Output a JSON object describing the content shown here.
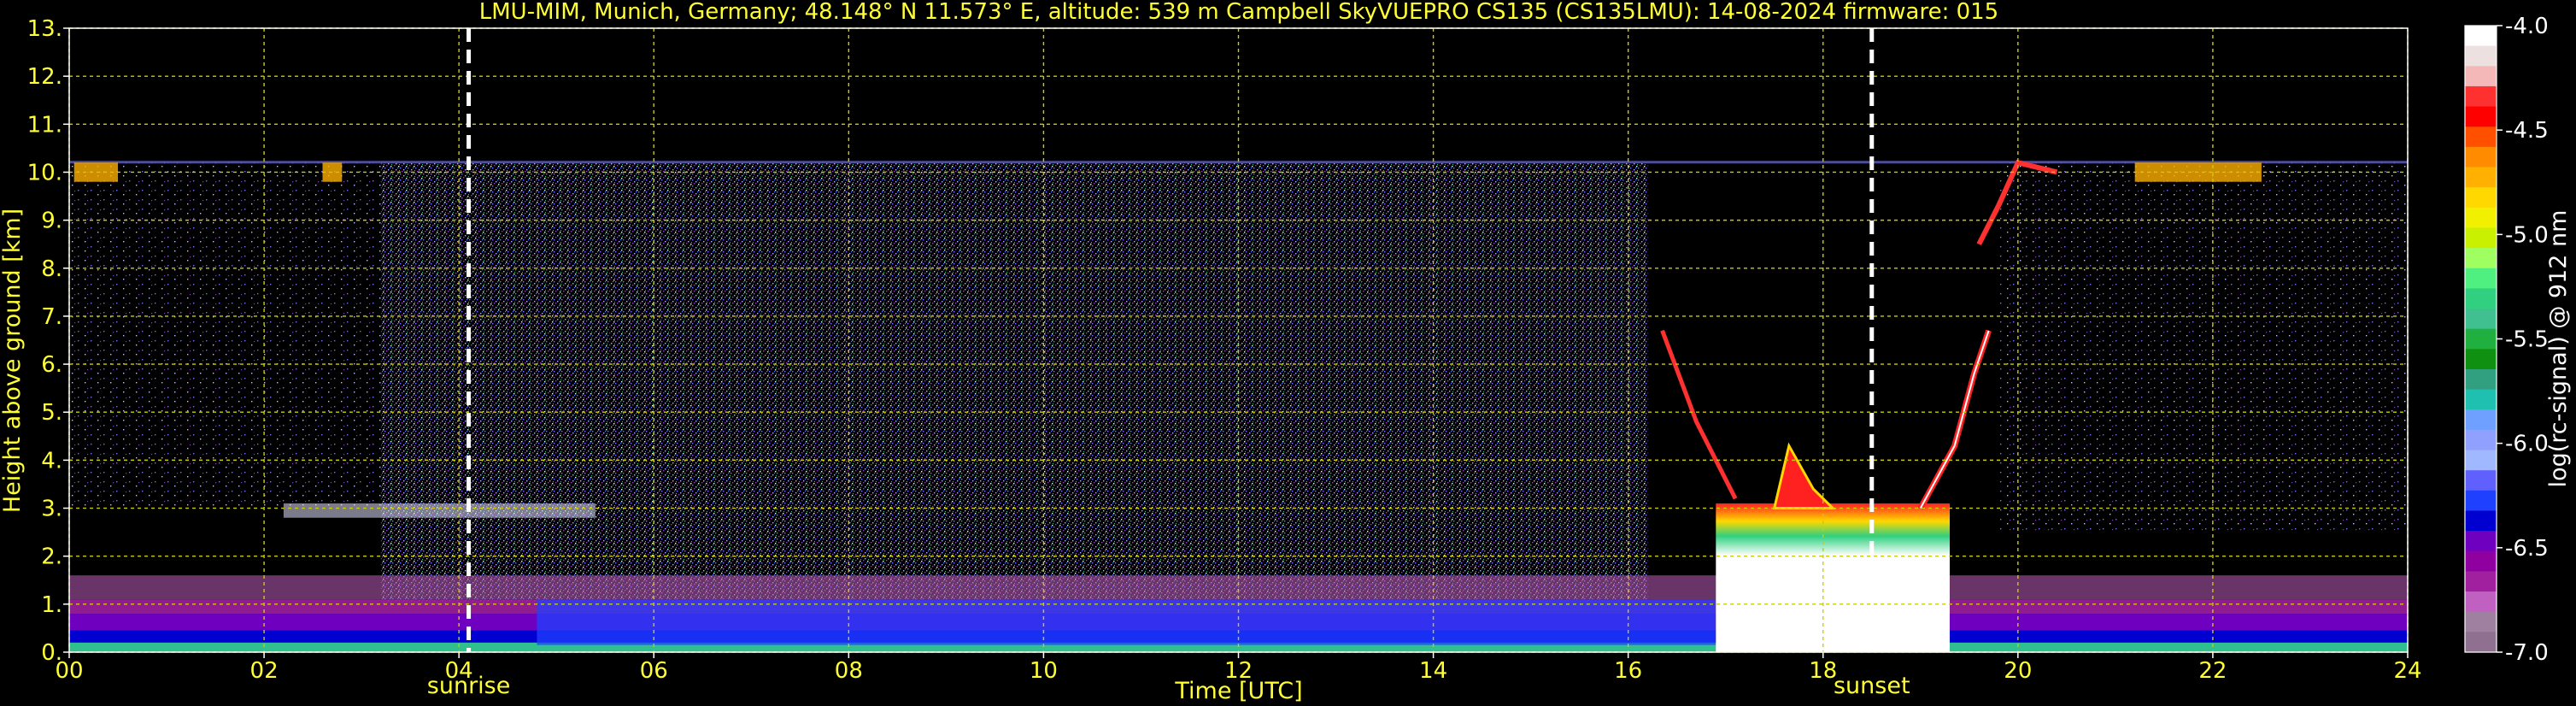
{
  "title": "LMU-MIM, Munich, Germany; 48.148° N 11.573° E, altitude: 539 m    Campbell SkyVUEPRO CS135 (CS135LMU): 14-08-2024    firmware: 015",
  "colors": {
    "background": "#000000",
    "text": "#ffff33",
    "grid": "#cccc00",
    "marker": "#ffffff"
  },
  "chart_data": {
    "type": "heatmap",
    "xlabel": "Time [UTC]",
    "ylabel": "Height above ground [km]",
    "xlim": [
      0,
      24
    ],
    "ylim": [
      0,
      13
    ],
    "x_ticks": [
      "00",
      "02",
      "04",
      "06",
      "08",
      "10",
      "12",
      "14",
      "16",
      "18",
      "20",
      "22",
      "24"
    ],
    "y_ticks": [
      "0.",
      "1.",
      "2.",
      "3.",
      "4.",
      "5.",
      "6.",
      "7.",
      "8.",
      "9.",
      "10.",
      "11.",
      "12.",
      "13."
    ],
    "grid": true,
    "markers": [
      {
        "label": "sunrise",
        "time_utc": 4.1
      },
      {
        "label": "sunset",
        "time_utc": 18.5
      }
    ],
    "colorbar": {
      "label": "log(rc-signal) @ 912 nm",
      "range": [
        -7.0,
        -4.0
      ],
      "ticks": [
        "-4.0",
        "-4.5",
        "-5.0",
        "-5.5",
        "-6.0",
        "-6.5",
        "-7.0"
      ],
      "colors": [
        "#ffffff",
        "#ece0e0",
        "#f4b8b8",
        "#ff3030",
        "#ff0000",
        "#ff5000",
        "#ff8c00",
        "#ffb000",
        "#ffd800",
        "#f0f000",
        "#c8f000",
        "#a0ff60",
        "#50f080",
        "#30d080",
        "#40c090",
        "#20b040",
        "#109010",
        "#30a080",
        "#20c0b0",
        "#70a0ff",
        "#90a0ff",
        "#a0b8ff",
        "#6060ff",
        "#2040ff",
        "#0000d0",
        "#7000c0",
        "#9000a0",
        "#a020a0",
        "#c060c0",
        "#a080a0",
        "#907090"
      ]
    },
    "data_coverage_top_km": 10.2,
    "features": [
      {
        "name": "boundary layer aerosol",
        "time_utc": [
          0,
          24
        ],
        "height_km": [
          0,
          1.6
        ]
      },
      {
        "name": "convective cloud",
        "time_utc": [
          16.9,
          19.3
        ],
        "height_km": [
          0,
          4.3
        ]
      },
      {
        "name": "cloud edge ascent",
        "time_utc": [
          19.0,
          19.7
        ],
        "height_km": [
          3.0,
          6.7
        ]
      },
      {
        "name": "upper cloud",
        "time_utc": [
          19.6,
          20.4
        ],
        "height_km": [
          8.5,
          10.2
        ]
      },
      {
        "name": "morning cloud layer",
        "time_utc": [
          2.2,
          5.4
        ],
        "height_km": [
          2.7,
          3.1
        ]
      }
    ]
  }
}
